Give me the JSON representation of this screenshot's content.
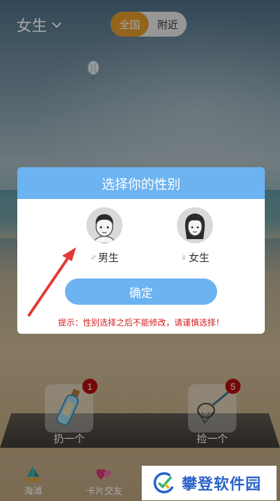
{
  "header": {
    "gender_selected": "女生",
    "scope_tabs": [
      {
        "label": "全国",
        "active": true
      },
      {
        "label": "附近",
        "active": false
      }
    ]
  },
  "actions": [
    {
      "label": "扔一个",
      "badge": "1",
      "icon": "bottle-icon"
    },
    {
      "label": "捡一个",
      "badge": "5",
      "icon": "net-icon"
    }
  ],
  "nav": [
    {
      "label": "海滩",
      "icon": "sailboat-icon"
    },
    {
      "label": "卡片交友",
      "icon": "hearts-icon"
    }
  ],
  "modal": {
    "title": "选择你的性别",
    "options": [
      {
        "label": "男生",
        "symbol": "♂"
      },
      {
        "label": "女生",
        "symbol": "♀"
      }
    ],
    "confirm_label": "确定",
    "hint": "提示：性别选择之后不能修改，请谨慎选择！"
  },
  "watermark": {
    "text": "攀登软件园"
  },
  "colors": {
    "accent": "#6cb3f2",
    "tab_active": "#e49a2a",
    "badge": "#b20d0d",
    "hint": "#d11e1e",
    "arrow": "#e53935",
    "watermark_text": "#2a62c9"
  }
}
